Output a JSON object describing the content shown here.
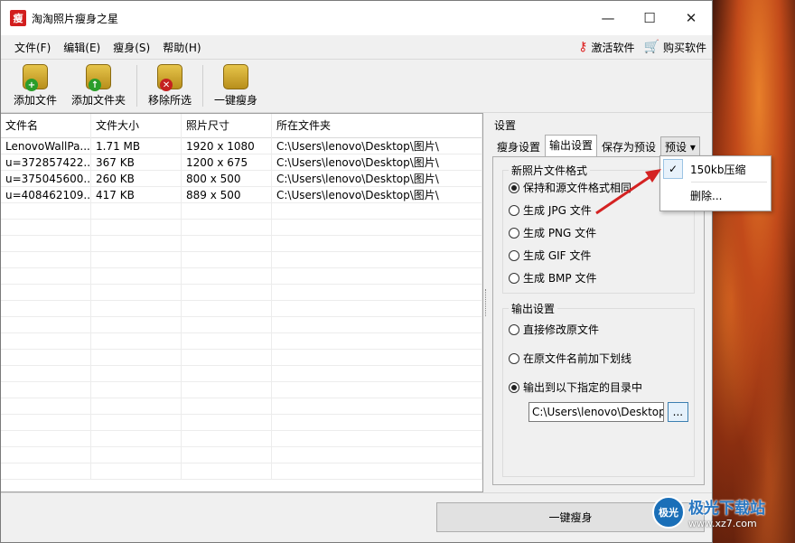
{
  "window": {
    "title": "淘淘照片瘦身之星",
    "icon_text": "瘦"
  },
  "controls": {
    "minimize": "—",
    "maximize": "☐",
    "close": "✕"
  },
  "menu": {
    "items": [
      "文件(F)",
      "编辑(E)",
      "瘦身(S)",
      "帮助(H)"
    ],
    "activate": "激活软件",
    "buy": "购买软件"
  },
  "toolbar": {
    "add_file": "添加文件",
    "add_folder": "添加文件夹",
    "remove_selected": "移除所选",
    "one_click": "一键瘦身"
  },
  "table": {
    "headers": [
      "文件名",
      "文件大小",
      "照片尺寸",
      "所在文件夹"
    ],
    "rows": [
      [
        "LenovoWallPa...",
        "1.71 MB",
        "1920 x 1080",
        "C:\\Users\\lenovo\\Desktop\\图片\\"
      ],
      [
        "u=372857422...",
        "367 KB",
        "1200 x 675",
        "C:\\Users\\lenovo\\Desktop\\图片\\"
      ],
      [
        "u=375045600...",
        "260 KB",
        "800 x 500",
        "C:\\Users\\lenovo\\Desktop\\图片\\"
      ],
      [
        "u=408462109...",
        "417 KB",
        "889 x 500",
        "C:\\Users\\lenovo\\Desktop\\图片\\"
      ]
    ]
  },
  "settings": {
    "title": "设置",
    "tabs": [
      "瘦身设置",
      "输出设置",
      "保存为预设",
      "预设 ▾"
    ],
    "format_group": "新照片文件格式",
    "formats": [
      "保持和源文件格式相同",
      "生成 JPG 文件",
      "生成 PNG 文件",
      "生成 GIF 文件",
      "生成 BMP 文件"
    ],
    "output_group": "输出设置",
    "outputs": [
      "直接修改原文件",
      "在原文件名前加下划线",
      "输出到以下指定的目录中"
    ],
    "output_path": "C:\\Users\\lenovo\\Desktop\\o",
    "browse": "..."
  },
  "popup": {
    "check": "✓",
    "preset": "150kb压缩",
    "delete": "删除..."
  },
  "run_button": "一键瘦身",
  "watermark": {
    "logo": "极光",
    "title": "极光下载站",
    "url": "www.xz7.com"
  }
}
